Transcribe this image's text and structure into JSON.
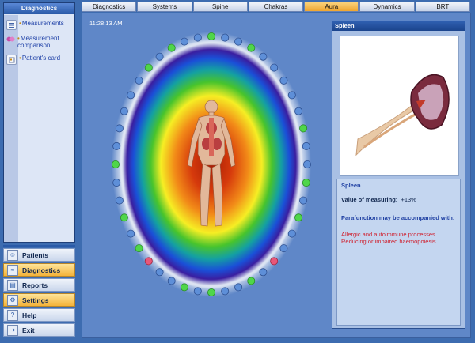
{
  "diagnostics": {
    "title": "Diagnostics",
    "items": [
      {
        "label": "Measurements",
        "icon": "list-icon"
      },
      {
        "label": "Measurement comparison",
        "icon": "compare-icon"
      },
      {
        "label": "Patient's card",
        "icon": "card-icon"
      }
    ]
  },
  "nav": {
    "items": [
      {
        "label": "Patients",
        "icon": "patients-icon",
        "active": false
      },
      {
        "label": "Diagnostics",
        "icon": "diagnostics-icon",
        "active": true
      },
      {
        "label": "Reports",
        "icon": "reports-icon",
        "active": false
      },
      {
        "label": "Settings",
        "icon": "settings-icon",
        "active": true
      },
      {
        "label": "Help",
        "icon": "help-icon",
        "active": false
      },
      {
        "label": "Exit",
        "icon": "exit-icon",
        "active": false
      }
    ]
  },
  "tabs": [
    {
      "label": "Diagnostics",
      "active": false
    },
    {
      "label": "Systems",
      "active": false
    },
    {
      "label": "Spine",
      "active": false
    },
    {
      "label": "Chakras",
      "active": false
    },
    {
      "label": "Aura",
      "active": true
    },
    {
      "label": "Dynamics",
      "active": false
    },
    {
      "label": "BRT",
      "active": false
    }
  ],
  "time": "11:28:13 AM",
  "aura": {
    "dots": [
      "green",
      "blue",
      "blue",
      "green",
      "blue",
      "blue",
      "blue",
      "blue",
      "blue",
      "green",
      "blue",
      "blue",
      "green",
      "blue",
      "green",
      "blue",
      "blue",
      "pink",
      "blue",
      "green",
      "blue",
      "blue",
      "green",
      "blue",
      "green",
      "blue",
      "blue",
      "pink",
      "green",
      "blue",
      "green",
      "blue",
      "blue",
      "green",
      "blue",
      "blue",
      "blue",
      "blue",
      "blue",
      "green",
      "blue",
      "green",
      "blue",
      "blue"
    ]
  },
  "organ": {
    "header": "Spleen",
    "info_title": "Spleen",
    "measure_label": "Value of measuring:",
    "measure_value": "+13%",
    "para_title": "Parafunction may be accompanied with:",
    "para_items": [
      "Allergic and autoimmune processes",
      "Reducing or impaired haemopoiesis"
    ]
  },
  "colors": {
    "accent": "#f0a630",
    "panel": "#5f87c8",
    "link": "#1d3fa6",
    "warning": "#d01e2c"
  }
}
